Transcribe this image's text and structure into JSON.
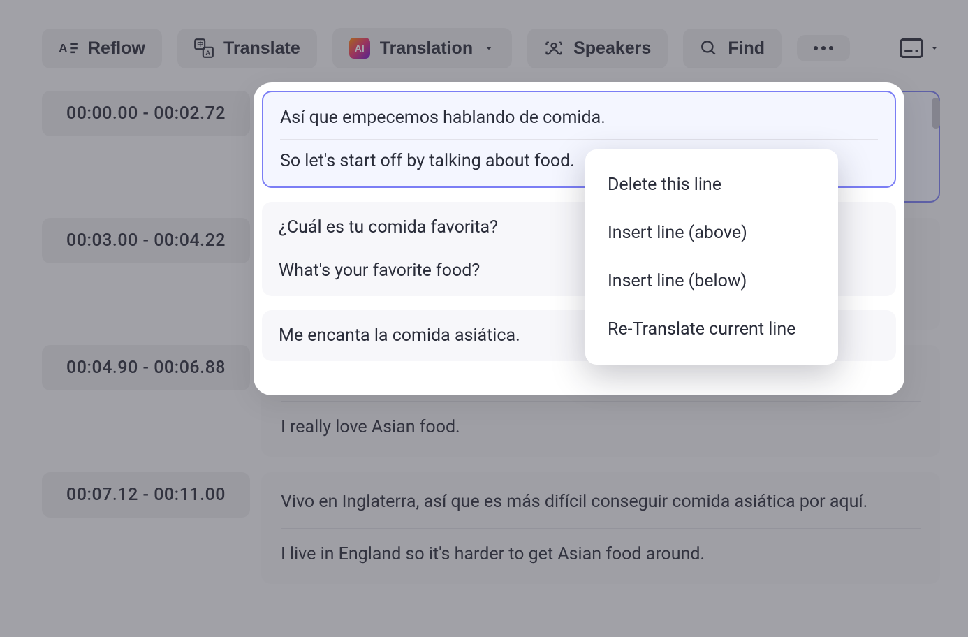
{
  "toolbar": {
    "reflow": "Reflow",
    "translate": "Translate",
    "translation": "Translation",
    "speakers": "Speakers",
    "find": "Find",
    "ai_badge": "AI"
  },
  "context_menu": {
    "delete": "Delete this line",
    "insert_above": "Insert line (above)",
    "insert_below": "Insert line (below)",
    "retranslate": "Re-Translate current line"
  },
  "lines": [
    {
      "time": "00:00.00 - 00:02.72",
      "primary": "Así que empecemos hablando de comida.",
      "secondary": "So let's start off by talking about food."
    },
    {
      "time": "00:03.00 - 00:04.22",
      "primary": "¿Cuál es tu comida favorita?",
      "secondary": "What's your favorite food?"
    },
    {
      "time": "00:04.90 - 00:06.88",
      "primary": "Me encanta la comida asiática.",
      "secondary": "I really love Asian food."
    },
    {
      "time": "00:07.12  -  00:11.00",
      "primary": "Vivo en Inglaterra, así que es más difícil conseguir comida asiática por aquí.",
      "secondary": "I live in England so it's harder to get Asian food around."
    }
  ]
}
